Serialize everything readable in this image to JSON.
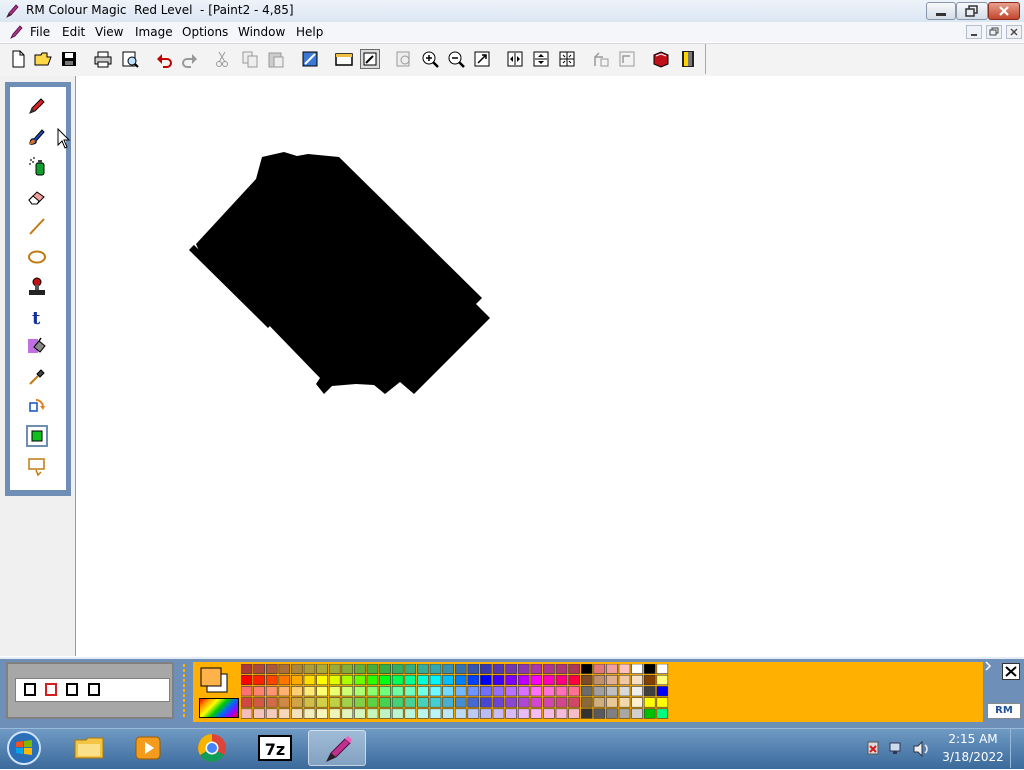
{
  "window": {
    "title": "RM Colour Magic  Red Level  - [Paint2 - 4,85]"
  },
  "menu": {
    "items": [
      "File",
      "Edit",
      "View",
      "Image",
      "Options",
      "Window",
      "Help"
    ]
  },
  "toolbar": {
    "buttons": [
      "new-file",
      "open-folder",
      "save",
      "print",
      "print-preview",
      "undo",
      "redo",
      "cut",
      "copy",
      "paste",
      "resize-image",
      "frame",
      "select-draw",
      "zoom-normal",
      "zoom-in",
      "zoom-out",
      "zoom-fit",
      "flip-horizontal",
      "flip-vertical",
      "grid",
      "rotate-left",
      "rotate-right",
      "help-book",
      "exit"
    ],
    "pressed": "select-draw"
  },
  "tools": [
    "pencil",
    "brush",
    "spray-can",
    "eraser",
    "line",
    "ellipse",
    "stamp",
    "text",
    "fill-bucket",
    "eyedropper",
    "rotate-shape",
    "filled-rectangle",
    "select-area"
  ],
  "selected_tool": "filled-rectangle",
  "canvas": {
    "background": "#ffffff",
    "shape_color": "#000000"
  },
  "brush_shapes": [
    "square-black",
    "square-red",
    "square-black-2",
    "square-black-3"
  ],
  "palette": {
    "foreground": "#ffb14a",
    "background": "#ffffff",
    "frame_color": "#ffb000"
  },
  "taskbar": {
    "apps": [
      "windows-explorer",
      "media-player",
      "chrome",
      "7-zip",
      "rm-colour-magic"
    ],
    "active_app": "rm-colour-magic",
    "seven_zip_label": "7z",
    "logo_label": "RM",
    "time": "2:15 AM",
    "date": "3/18/2022"
  }
}
